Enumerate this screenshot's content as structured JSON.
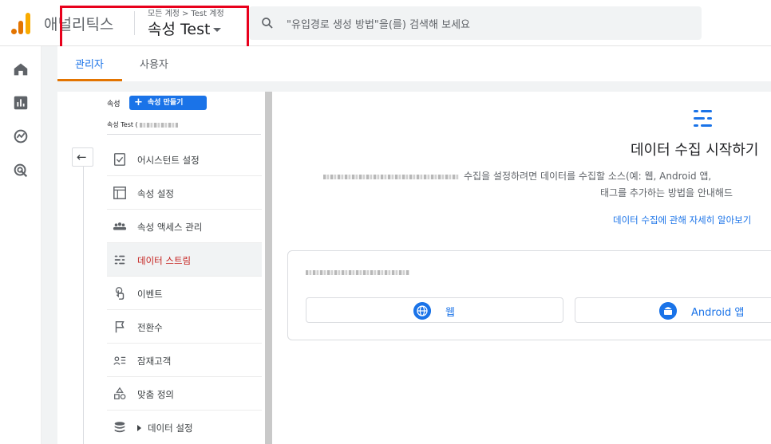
{
  "app": {
    "name": "애널리틱스",
    "breadcrumb": {
      "all_accounts": "모든 계정",
      "separator": ">",
      "account": "Test 계정"
    },
    "property_selector": "속성 Test"
  },
  "search": {
    "placeholder": "\"유입경로 생성 방법\"을(를) 검색해 보세요"
  },
  "rail": {
    "items": [
      {
        "icon": "home-icon"
      },
      {
        "icon": "reports-icon"
      },
      {
        "icon": "explore-icon"
      },
      {
        "icon": "advertising-icon"
      }
    ]
  },
  "tabs": [
    {
      "label": "관리자",
      "active": true
    },
    {
      "label": "사용자",
      "active": false
    }
  ],
  "property_panel": {
    "label": "속성",
    "create_button": "속성 만들기",
    "current_property": "속성 Test ("
  },
  "menu": [
    {
      "label": "어시스턴트 설정",
      "icon": "checklist-icon"
    },
    {
      "label": "속성 설정",
      "icon": "layout-icon"
    },
    {
      "label": "속성 액세스 관리",
      "icon": "people-icon"
    },
    {
      "label": "데이터 스트림",
      "icon": "data-streams-icon",
      "active": true
    },
    {
      "label": "이벤트",
      "icon": "touch-icon"
    },
    {
      "label": "전환수",
      "icon": "flag-icon"
    },
    {
      "label": "잠재고객",
      "icon": "audience-icon"
    },
    {
      "label": "맞춤 정의",
      "icon": "shapes-icon"
    },
    {
      "label": "데이터 설정",
      "icon": "database-icon",
      "expandable": true
    }
  ],
  "content": {
    "title": "데이터 수집 시작하기",
    "desc_line1": "수집을 설정하려면 데이터를 수집할 소스(예: 웹, Android 앱,",
    "desc_line2": "태그를 추가하는 방법을 안내해드",
    "learn_more": "데이터 수집에 관해 자세히 알아보기",
    "platforms": [
      {
        "label": "웹",
        "icon": "globe-icon"
      },
      {
        "label": "Android 앱",
        "icon": "android-icon"
      }
    ]
  },
  "colors": {
    "accent": "#1a73e8",
    "active_menu": "#c5221f",
    "tab_underline": "#e37400",
    "highlight": "#e8001c"
  }
}
